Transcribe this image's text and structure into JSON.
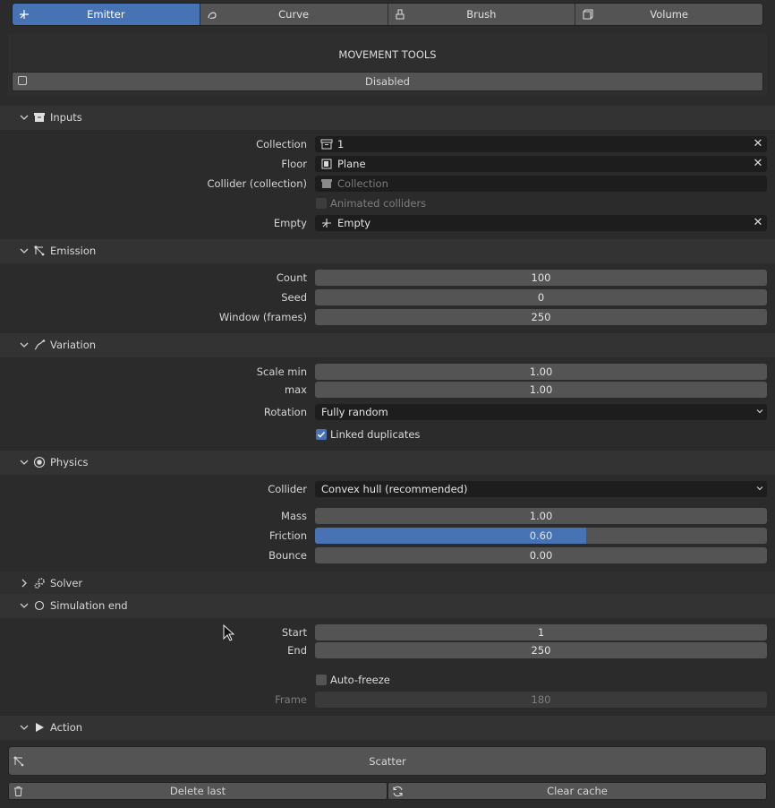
{
  "tabs": [
    {
      "label": "Emitter",
      "icon": "emitter-icon",
      "active": true
    },
    {
      "label": "Curve",
      "icon": "curve-icon",
      "active": false
    },
    {
      "label": "Brush",
      "icon": "brush-icon",
      "active": false
    },
    {
      "label": "Volume",
      "icon": "volume-icon",
      "active": false
    }
  ],
  "movement": {
    "title": "MOVEMENT TOOLS",
    "toggle_label": "Disabled",
    "toggle_checked": false
  },
  "inputs": {
    "header": "Inputs",
    "collection_label": "Collection",
    "collection_value": "1",
    "floor_label": "Floor",
    "floor_value": "Plane",
    "collider_label": "Collider (collection)",
    "collider_placeholder": "Collection",
    "animated_label": "Animated colliders",
    "animated_checked": false,
    "empty_label": "Empty",
    "empty_value": "Empty"
  },
  "emission": {
    "header": "Emission",
    "count_label": "Count",
    "count_value": "100",
    "seed_label": "Seed",
    "seed_value": "0",
    "window_label": "Window (frames)",
    "window_value": "250"
  },
  "variation": {
    "header": "Variation",
    "scale_min_label": "Scale min",
    "scale_min_value": "1.00",
    "max_label": "max",
    "max_value": "1.00",
    "rotation_label": "Rotation",
    "rotation_value": "Fully random",
    "linked_label": "Linked duplicates",
    "linked_checked": true
  },
  "physics": {
    "header": "Physics",
    "collider_label": "Collider",
    "collider_value": "Convex hull (recommended)",
    "mass_label": "Mass",
    "mass_value": "1.00",
    "friction_label": "Friction",
    "friction_value": "0.60",
    "friction_fill": 0.6,
    "bounce_label": "Bounce",
    "bounce_value": "0.00"
  },
  "solver": {
    "header": "Solver",
    "expanded": false
  },
  "simulation_end": {
    "header": "Simulation end",
    "start_label": "Start",
    "start_value": "1",
    "end_label": "End",
    "end_value": "250",
    "autofreeze_label": "Auto-freeze",
    "autofreeze_checked": false,
    "frame_label": "Frame",
    "frame_value": "180"
  },
  "action": {
    "header": "Action",
    "scatter_label": "Scatter",
    "delete_label": "Delete last",
    "clear_label": "Clear cache"
  },
  "colors": {
    "accent": "#4772b3",
    "field": "#545454",
    "panel": "#2b2b2b",
    "dark_field": "#1d1d1d"
  }
}
